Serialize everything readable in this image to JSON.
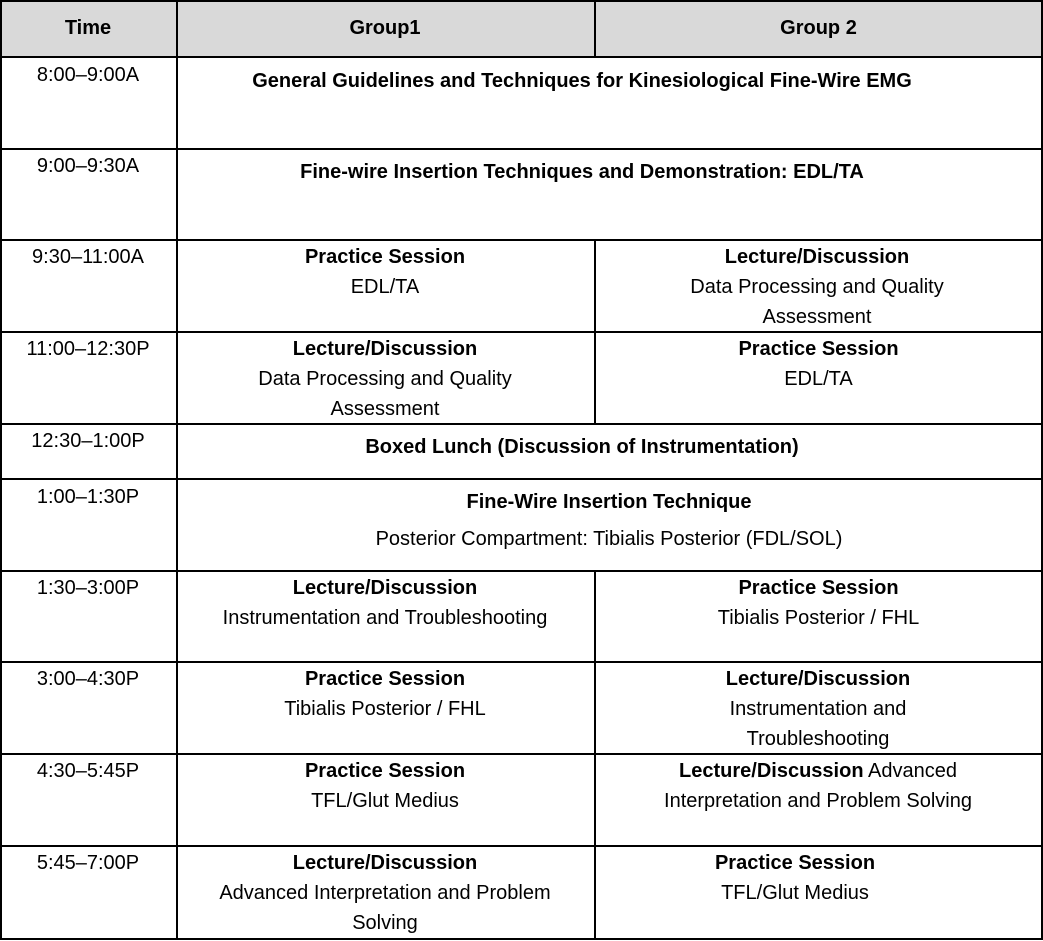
{
  "headers": {
    "time": "Time",
    "group1": "Group1",
    "group2": "Group 2"
  },
  "rows": [
    {
      "time": "8:00–9:00A",
      "span": "General Guidelines and Techniques for Kinesiological Fine-Wire EMG"
    },
    {
      "time": "9:00–9:30A",
      "span": "Fine-wire Insertion Techniques and Demonstration: EDL/TA"
    },
    {
      "time": "9:30–11:00A",
      "g1": {
        "title": "Practice Session",
        "text": "EDL/TA"
      },
      "g2": {
        "title": "Lecture/Discussion",
        "text": "Data Processing and Quality Assessment"
      }
    },
    {
      "time": "11:00–12:30P",
      "g1": {
        "title": "Lecture/Discussion",
        "text": "Data Processing and Quality Assessment"
      },
      "g2": {
        "title": "Practice Session",
        "text": "EDL/TA"
      }
    },
    {
      "time": "12:30–1:00P",
      "span": "Boxed Lunch (Discussion of Instrumentation)"
    },
    {
      "time": "1:00–1:30P",
      "span_title": "Fine-Wire Insertion Technique",
      "span_text": "Posterior Compartment: Tibialis Posterior (FDL/SOL)"
    },
    {
      "time": "1:30–3:00P",
      "g1": {
        "title": "Lecture/Discussion",
        "text": "Instrumentation and Troubleshooting"
      },
      "g2": {
        "title": "Practice Session",
        "text": "Tibialis Posterior / FHL"
      }
    },
    {
      "time": "3:00–4:30P",
      "g1": {
        "title": "Practice Session",
        "text": "Tibialis Posterior / FHL"
      },
      "g2": {
        "title": "Lecture/Discussion",
        "text": "Instrumentation and Troubleshooting"
      }
    },
    {
      "time": "4:30–5:45P",
      "g1": {
        "title": "Practice Session",
        "text": "TFL/Glut Medius"
      },
      "g2": {
        "title": "Lecture/Discussion",
        "text": "Advanced Interpretation and  Problem Solving"
      }
    },
    {
      "time": "5:45–7:00P",
      "g1": {
        "title": "Lecture/Discussion",
        "text": "Advanced Interpretation and Problem Solving"
      },
      "g2": {
        "title": "Practice Session",
        "text": "TFL/Glut Medius"
      }
    }
  ]
}
